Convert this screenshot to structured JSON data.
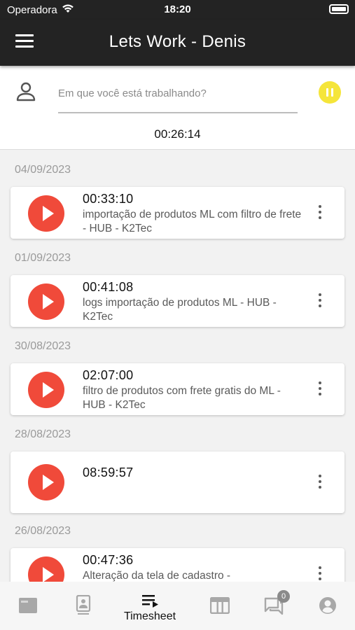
{
  "status_bar": {
    "carrier": "Operadora",
    "time": "18:20"
  },
  "app_bar": {
    "title": "Lets Work - Denis"
  },
  "tracker": {
    "placeholder": "Em que você está trabalhando?",
    "elapsed": "00:26:14"
  },
  "days": [
    {
      "date": "04/09/2023",
      "entries": [
        {
          "duration": "00:33:10",
          "description": "importação de produtos ML com filtro de frete - HUB - K2Tec"
        }
      ]
    },
    {
      "date": "01/09/2023",
      "entries": [
        {
          "duration": "00:41:08",
          "description": "logs importação de produtos ML - HUB - K2Tec"
        }
      ]
    },
    {
      "date": "30/08/2023",
      "entries": [
        {
          "duration": "02:07:00",
          "description": "filtro de produtos com frete gratis do ML - HUB - K2Tec"
        }
      ]
    },
    {
      "date": "28/08/2023",
      "entries": [
        {
          "duration": "08:59:57",
          "description": ""
        }
      ]
    },
    {
      "date": "26/08/2023",
      "entries": [
        {
          "duration": "00:47:36",
          "description": "Alteração da tela de cadastro -"
        }
      ]
    }
  ],
  "bottom_nav": {
    "items": [
      {
        "icon": "dashboard-icon"
      },
      {
        "icon": "badge-icon"
      },
      {
        "icon": "timesheet-icon",
        "label": "Timesheet"
      },
      {
        "icon": "table-icon"
      },
      {
        "icon": "chat-icon",
        "badge": "0"
      },
      {
        "icon": "account-circle-icon"
      }
    ]
  },
  "colors": {
    "accent_play": "#f04a3a",
    "accent_pause": "#f5e53a",
    "app_bar": "#232323"
  }
}
